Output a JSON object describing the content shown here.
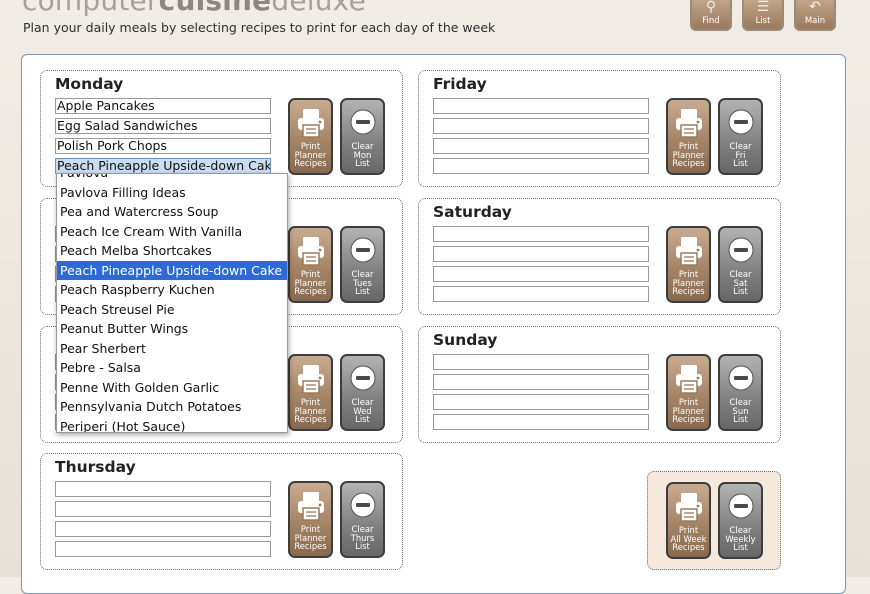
{
  "header": {
    "brand_light": "computer",
    "brand_bold": "cuisine",
    "brand_tail": "deluxe",
    "subtitle": "Plan your daily meals by selecting recipes to print for each day of the week"
  },
  "nav": [
    {
      "label": "Find",
      "icon": "magnifier-icon"
    },
    {
      "label": "List",
      "icon": "list-icon"
    },
    {
      "label": "Main",
      "icon": "back-arrow-icon"
    }
  ],
  "days": {
    "monday": {
      "name": "Monday",
      "slots": [
        "Apple Pancakes",
        "Egg Salad Sandwiches",
        "Polish Pork Chops",
        "Peach Pineapple Upside-down Cake"
      ],
      "print": [
        "Print",
        "Planner",
        "Recipes"
      ],
      "clear": [
        "Clear",
        "Mon",
        "List"
      ]
    },
    "tuesday": {
      "name": "",
      "slots": [
        "",
        "",
        "",
        ""
      ],
      "print": [
        "Print",
        "Planner",
        "Recipes"
      ],
      "clear": [
        "Clear",
        "Tues",
        "List"
      ]
    },
    "wednesday": {
      "name": "",
      "slots": [
        "",
        "",
        "",
        ""
      ],
      "print": [
        "Print",
        "Planner",
        "Recipes"
      ],
      "clear": [
        "Clear",
        "Wed",
        "List"
      ]
    },
    "thursday": {
      "name": "Thursday",
      "slots": [
        "",
        "",
        "",
        ""
      ],
      "print": [
        "Print",
        "Planner",
        "Recipes"
      ],
      "clear": [
        "Clear",
        "Thurs",
        "List"
      ]
    },
    "friday": {
      "name": "Friday",
      "slots": [
        "",
        "",
        "",
        ""
      ],
      "print": [
        "Print",
        "Planner",
        "Recipes"
      ],
      "clear": [
        "Clear",
        "Fri",
        "List"
      ]
    },
    "saturday": {
      "name": "Saturday",
      "slots": [
        "",
        "",
        "",
        ""
      ],
      "print": [
        "Print",
        "Planner",
        "Recipes"
      ],
      "clear": [
        "Clear",
        "Sat",
        "List"
      ]
    },
    "sunday": {
      "name": "Sunday",
      "slots": [
        "",
        "",
        "",
        ""
      ],
      "print": [
        "Print",
        "Planner",
        "Recipes"
      ],
      "clear": [
        "Clear",
        "Sun",
        "List"
      ]
    }
  },
  "weekly": {
    "print": [
      "Print",
      "All Week",
      "Recipes"
    ],
    "clear": [
      "Clear",
      "Weekly",
      "List"
    ]
  },
  "dropdown": {
    "items": [
      "Pavlova",
      "Pavlova Filling Ideas",
      "Pea and Watercress Soup",
      "Peach Ice Cream With Vanilla",
      "Peach Melba Shortcakes",
      "Peach Pineapple Upside-down Cake",
      "Peach Raspberry Kuchen",
      "Peach Streusel Pie",
      "Peanut Butter Wings",
      "Pear Sherbert",
      "Pebre - Salsa",
      "Penne With Golden Garlic",
      "Pennsylvania Dutch Potatoes",
      "Periperi (Hot Sauce)"
    ],
    "selected_index": 5
  },
  "colors": {
    "accent": "#2d6ad8",
    "print_button": "#a58466",
    "clear_button": "#838383",
    "panel_border": "#7e95b2"
  }
}
